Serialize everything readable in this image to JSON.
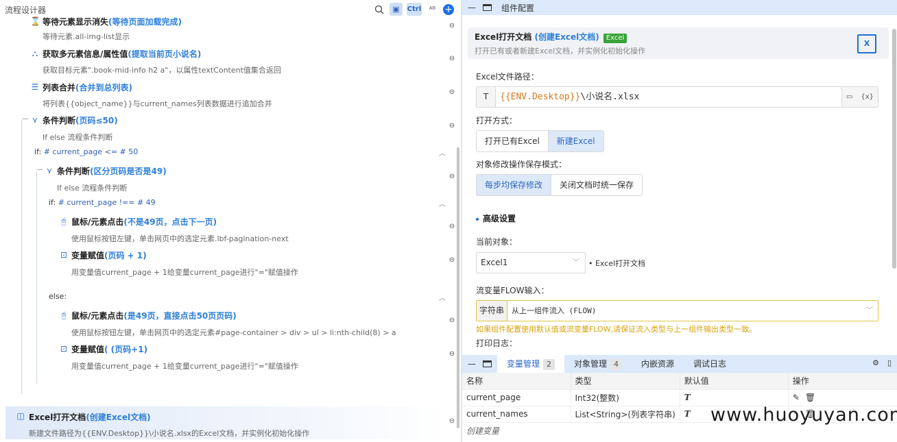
{
  "left": {
    "title": "流程设计器",
    "nodes": [
      {
        "title": "等待元素显示消失",
        "sub": "(等待页面加载完成)",
        "desc": "等待元素.all-img-list显示"
      },
      {
        "title": "获取多元素信息/属性值",
        "sub": "(提取当前页小说名)",
        "desc": "获取目标元素\".book-mid-info h2 a\"，以属性textContent值集合返回"
      },
      {
        "title": "列表合并",
        "sub": "(合并到总列表)",
        "desc": "将列表{{object_name}}与current_names列表数据进行追加合并"
      },
      {
        "title": "条件判断",
        "sub": "(页码≤50)",
        "desc": "If else 流程条件判断"
      },
      {
        "title": "条件判断",
        "sub": "(区分页码是否是49)",
        "desc": "If else 流程条件判断"
      },
      {
        "title": "鼠标/元素点击",
        "sub": "(不是49页，点击下一页)",
        "desc": "使用鼠标按钮左键，单击网页中的选定元素.lbf-pagination-next"
      },
      {
        "title": "变量赋值",
        "sub": "(页码 + 1)",
        "desc": "用变量值current_page + 1给变量current_page进行\"=\"赋值操作"
      },
      {
        "title": "鼠标/元素点击",
        "sub": "(是49页，直接点击50页页码)",
        "desc": "使用鼠标按钮左键，单击网页中的选定元素#page-container > div > ul > li:nth-child(8) > a"
      },
      {
        "title": "变量赋值",
        "sub": "( (页码+1)",
        "desc": "用变量值current_page + 1给变量current_page进行\"=\"赋值操作"
      },
      {
        "title": "Excel打开文档",
        "sub": "(创建Excel文档)",
        "desc": "新建文件路径为{{ENV.Desktop}}\\小说名.xlsx的Excel文档，并实例化初始化操作"
      }
    ],
    "cond1": {
      "kw": "if:",
      "expr": "# current_page <= # 50"
    },
    "cond2": {
      "kw": "if:",
      "expr": "# current_page !== # 49"
    },
    "else_label": "else:"
  },
  "panel": {
    "title": "组件配置",
    "card_title": "Excel打开文档",
    "card_sub": "(创建Excel文档)",
    "card_badge": "Excel",
    "card_desc": "打开已有或者新建Excel文档，并实例化初始化操作",
    "path_label": "Excel文件路径：",
    "path_prefix": "T",
    "path_env": "{{ENV.Desktop}}",
    "path_rest": "\\小说名.xlsx",
    "open_label": "打开方式：",
    "open_options": [
      "打开已有Excel",
      "新建Excel"
    ],
    "save_label": "对象修改操作保存模式：",
    "save_options": [
      "每步均保存修改",
      "关闭文档时统一保存"
    ],
    "advanced": "高级设置",
    "obj_label": "当前对象：",
    "obj_value": "Excel1",
    "obj_note": "• Excel打开文档",
    "flow_label": "流变量FLOW输入：",
    "flow_prefix": "字符串",
    "flow_value": "从上一组件流入 (FLOW)",
    "flow_warn": "如果组件配置使用默认值或流变量FLOW,请保证流入类型与上一组件输出类型一致。",
    "log_label": "打印日志："
  },
  "bottom": {
    "tabs": [
      {
        "label": "变量管理",
        "count": "2"
      },
      {
        "label": "对象管理",
        "count": "4"
      },
      {
        "label": "内嵌资源",
        "count": ""
      },
      {
        "label": "调试日志",
        "count": ""
      }
    ],
    "columns": [
      "名称",
      "类型",
      "默认值",
      "操作"
    ],
    "rows": [
      {
        "name": "current_page",
        "type": "Int32(整数)",
        "default": "T"
      },
      {
        "name": "current_names",
        "type": "List<String>(列表字符串)",
        "default": "T"
      }
    ],
    "create": "创建变量"
  },
  "watermark": "www.huoyuyan.com"
}
